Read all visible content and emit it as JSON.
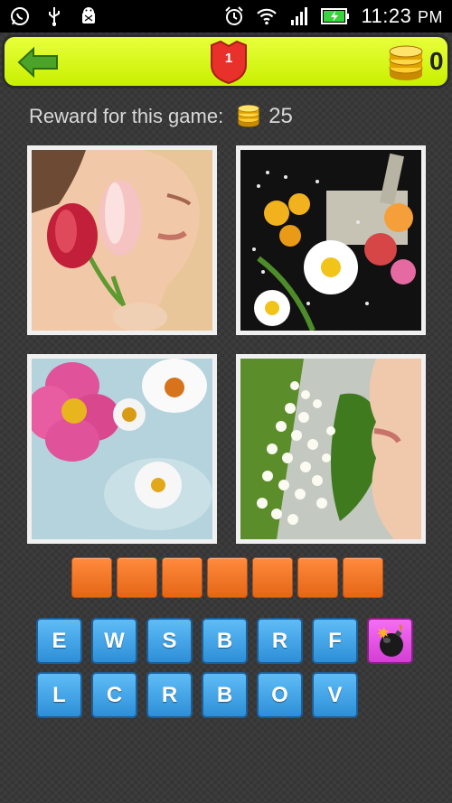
{
  "status_bar": {
    "time": "11:23",
    "ampm": "PM",
    "left_icons": [
      "whatsapp-icon",
      "usb-icon",
      "android-debug-icon"
    ],
    "right_icons": [
      "alarm-icon",
      "wifi-icon",
      "signal-icon",
      "battery-charging-icon"
    ]
  },
  "header": {
    "level": "1",
    "coins": "0"
  },
  "reward": {
    "label": "Reward for this game:",
    "value": "25"
  },
  "photos": [
    {
      "subject": "woman smelling red and pink tulips"
    },
    {
      "subject": "bouquet of daisies and wildflowers with mortar and pestle"
    },
    {
      "subject": "pink rose and daisies floating on water"
    },
    {
      "subject": "woman smelling lily of the valley"
    }
  ],
  "answer_slots": 7,
  "letters_row1": [
    "E",
    "W",
    "S",
    "B",
    "R",
    "F"
  ],
  "letters_row2": [
    "L",
    "C",
    "R",
    "B",
    "O",
    "V"
  ],
  "colors": {
    "topbar": "#d4f700",
    "slot": "#f07a2a",
    "key": "#3b9fe6",
    "bomb": "#e24fe2",
    "badge": "#e8312a"
  }
}
